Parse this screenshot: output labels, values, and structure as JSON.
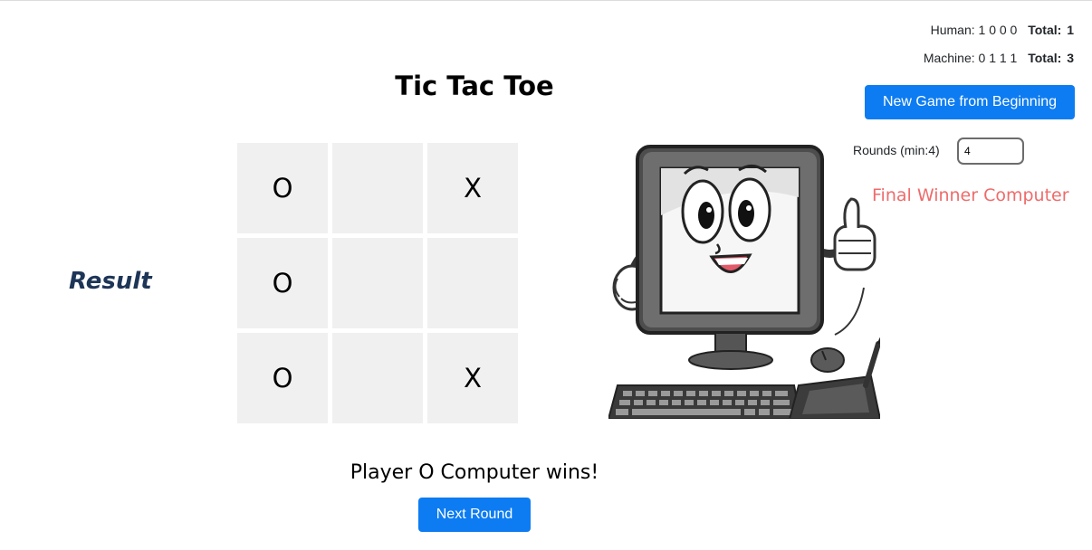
{
  "title": "Tic Tac Toe",
  "scores": {
    "human_label": "Human:",
    "human_rounds": "1 0 0 0",
    "human_total_label": "Total:",
    "human_total": "1",
    "machine_label": "Machine:",
    "machine_rounds": "0 1 1 1",
    "machine_total_label": "Total:",
    "machine_total": "3"
  },
  "controls": {
    "new_game_label": "New Game from Beginning",
    "rounds_label": "Rounds (min:4)",
    "rounds_value": "4",
    "next_round_label": "Next Round"
  },
  "final_winner": "Final Winner Computer",
  "result_label": "Result",
  "board": {
    "cells": [
      "O",
      "",
      "X",
      "O",
      "",
      "",
      "O",
      "",
      "X"
    ]
  },
  "status": "Player O Computer wins!",
  "colors": {
    "primary_button": "#0d7cf2",
    "final_winner_text": "#ef6b6b",
    "result_text": "#1d3557",
    "cell_background": "#f0f0f0"
  },
  "icons": {
    "illustration": "smiling-computer-thumbs-up"
  }
}
